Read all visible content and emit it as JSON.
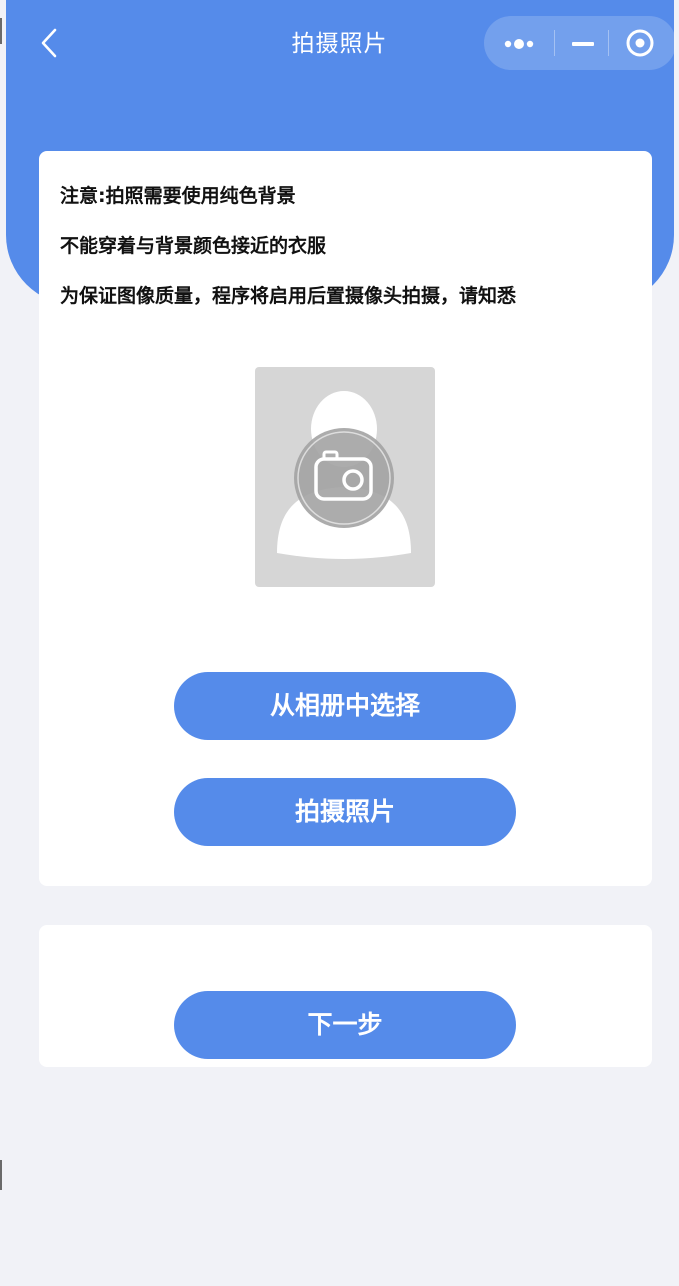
{
  "nav": {
    "title": "拍摄照片",
    "back_icon": "chevron-left-icon",
    "more_icon": "more-dots-icon",
    "minimize_icon": "minimize-icon",
    "close_icon": "target-circle-icon"
  },
  "notice": {
    "line1": "注意:拍照需要使用纯色背景",
    "line2": "不能穿着与背景颜色接近的衣服",
    "line3": "为保证图像质量，程序将启用后置摄像头拍摄，请知悉"
  },
  "photo": {
    "icon": "camera-icon",
    "figure": "person-silhouette"
  },
  "buttons": {
    "album": "从相册中选择",
    "camera": "拍摄照片",
    "next": "下一步"
  },
  "colors": {
    "accent": "#558bea",
    "background": "#f1f2f7",
    "card": "#ffffff",
    "placeholder": "#d6d6d6"
  }
}
